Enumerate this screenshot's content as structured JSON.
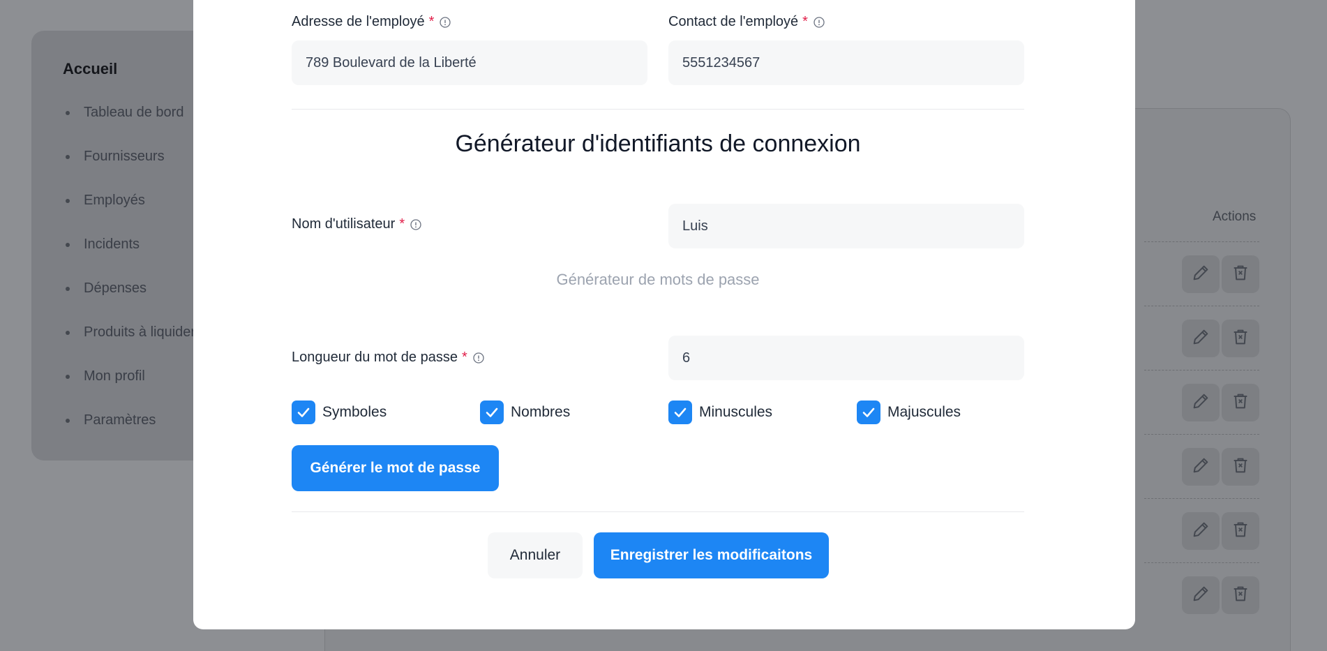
{
  "background": {
    "sidebar": {
      "title": "Accueil",
      "items": [
        {
          "label": "Tableau de bord"
        },
        {
          "label": "Fournisseurs"
        },
        {
          "label": "Employés"
        },
        {
          "label": "Incidents"
        },
        {
          "label": "Dépenses"
        },
        {
          "label": "Produits à liquider"
        },
        {
          "label": "Mon profil"
        },
        {
          "label": "Paramètres"
        }
      ]
    },
    "table": {
      "actions_header": "Actions",
      "row_icons": [
        "pencil-icon",
        "trash-icon"
      ]
    }
  },
  "modal": {
    "address": {
      "label": "Adresse de l'employé",
      "required_mark": "*",
      "value": "789 Boulevard de la Liberté"
    },
    "contact": {
      "label": "Contact de l'employé",
      "required_mark": "*",
      "value": "5551234567"
    },
    "credentials_title": "Générateur d'identifiants de connexion",
    "username": {
      "label": "Nom d'utilisateur",
      "required_mark": "*",
      "value": "Luis"
    },
    "password_generator_title": "Générateur de mots de passe",
    "password_length": {
      "label": "Longueur du mot de passe",
      "required_mark": "*",
      "value": "6"
    },
    "options": [
      {
        "label": "Symboles",
        "checked": true
      },
      {
        "label": "Nombres",
        "checked": true
      },
      {
        "label": "Minuscules",
        "checked": true
      },
      {
        "label": "Majuscules",
        "checked": true
      }
    ],
    "generate_button": "Générer le mot de passe",
    "cancel_button": "Annuler",
    "save_button": "Enregistrer les modificaitons"
  },
  "colors": {
    "accent": "#1d86f4",
    "required": "#e11d48",
    "overlay": "#8d8f93"
  }
}
